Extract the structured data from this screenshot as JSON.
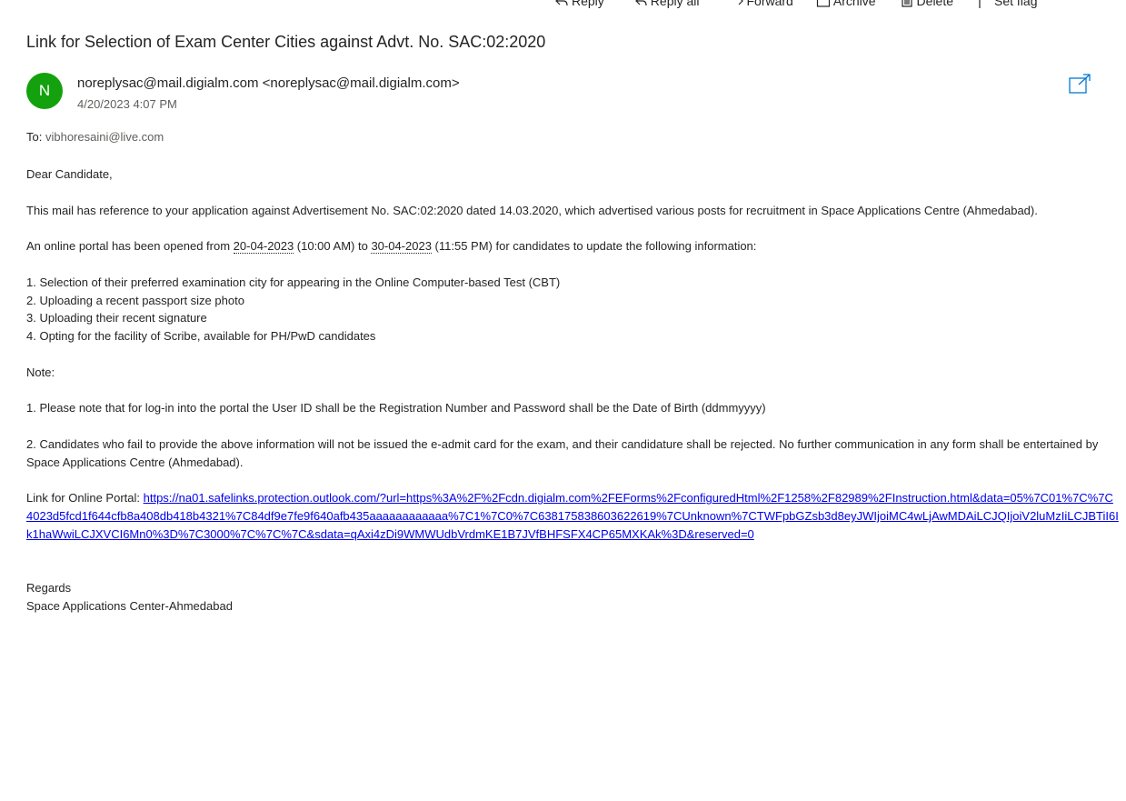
{
  "toolbar": {
    "reply": "Reply",
    "reply_all": "Reply all",
    "forward": "Forward",
    "archive": "Archive",
    "delete": "Delete",
    "set_flag": "Set flag"
  },
  "email": {
    "subject": "Link for Selection of Exam Center Cities against Advt. No. SAC:02:2020",
    "avatar_initial": "N",
    "avatar_color": "#13a10e",
    "sender": "noreplysac@mail.digialm.com <noreplysac@mail.digialm.com>",
    "datetime": "4/20/2023 4:07 PM",
    "to_label": "To:",
    "to_address": "vibhoresaini@live.com",
    "greeting": "Dear Candidate,",
    "para_reference": "This mail has reference to your application against Advertisement No. SAC:02:2020 dated 14.03.2020, which advertised various posts for recruitment in Space Applications Centre (Ahmedabad).",
    "portal_open": {
      "prefix": "An online portal has been opened from ",
      "start_date": "20-04-2023",
      "start_time": " (10:00 AM) to ",
      "end_date": "30-04-2023",
      "suffix": " (11:55 PM) for candidates to update the following information:"
    },
    "info_items": [
      "1. Selection of their preferred examination city for appearing in the Online Computer-based Test (CBT)",
      "2. Uploading a recent passport size photo",
      "3. Uploading their recent signature",
      "4. Opting for the facility of Scribe, available for PH/PwD candidates"
    ],
    "note_label": "Note:",
    "note_1": "1. Please note that for log-in into the portal the User ID shall be the Registration Number and Password shall be the Date of Birth (ddmmyyyy)",
    "note_2": "2. Candidates who fail to provide the above information will not be issued the e-admit card for the exam, and their candidature shall be rejected. No further communication in any form shall be entertained by Space Applications Centre (Ahmedabad).",
    "portal_label": "Link for Online Portal: ",
    "portal_url": "https://na01.safelinks.protection.outlook.com/?url=https%3A%2F%2Fcdn.digialm.com%2FEForms%2FconfiguredHtml%2F1258%2F82989%2FInstruction.html&data=05%7C01%7C%7C4023d5fcd1f644cfb8a408db418b4321%7C84df9e7fe9f640afb435aaaaaaaaaaaa%7C1%7C0%7C638175838603622619%7CUnknown%7CTWFpbGZsb3d8eyJWIjoiMC4wLjAwMDAiLCJQIjoiV2luMzIiLCJBTiI6Ik1haWwiLCJXVCI6Mn0%3D%7C3000%7C%7C%7C&sdata=qAxi4zDi9WMWUdbVrdmKE1B7JVfBHFSFX4CP65MXKAk%3D&reserved=0",
    "regards": "Regards",
    "signature": "Space Applications Center-Ahmedabad"
  }
}
